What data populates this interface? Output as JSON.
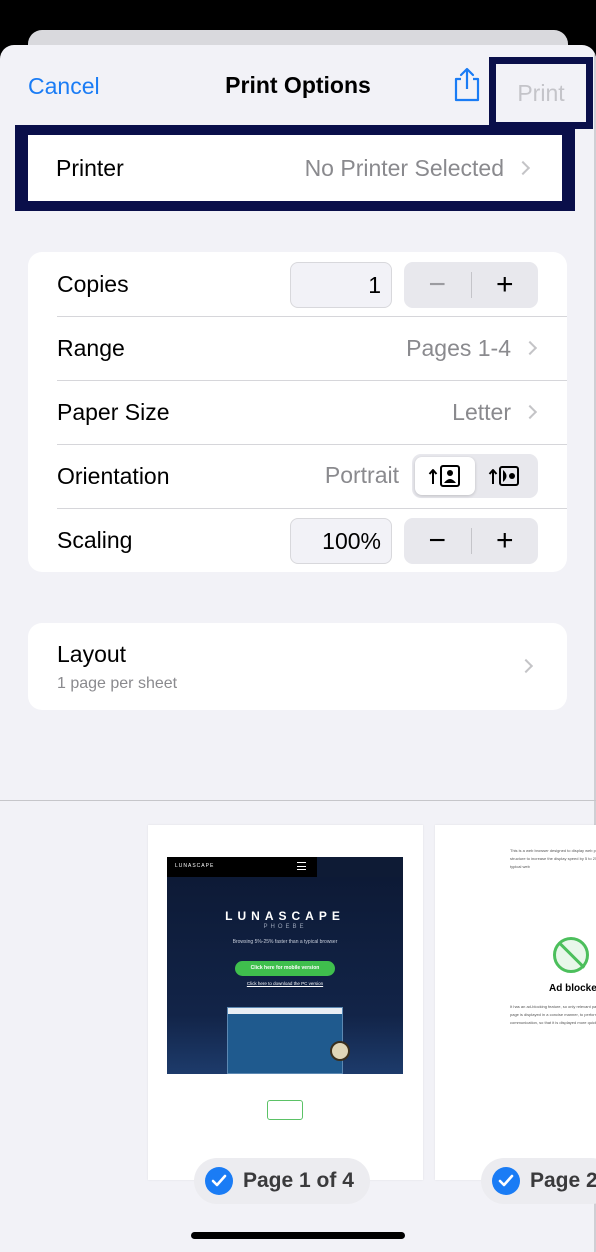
{
  "nav": {
    "cancel_label": "Cancel",
    "title": "Print Options",
    "print_label": "Print"
  },
  "printer": {
    "label": "Printer",
    "value": "No Printer Selected"
  },
  "settings": {
    "copies": {
      "label": "Copies",
      "value": "1",
      "minus": "−",
      "plus": "+"
    },
    "range": {
      "label": "Range",
      "value": "Pages 1-4"
    },
    "paper_size": {
      "label": "Paper Size",
      "value": "Letter"
    },
    "orientation": {
      "label": "Orientation",
      "value": "Portrait",
      "selected": "portrait"
    },
    "scaling": {
      "label": "Scaling",
      "value": "100%",
      "minus": "−",
      "plus": "+"
    }
  },
  "layout": {
    "label": "Layout",
    "subtitle": "1 page per sheet"
  },
  "preview": {
    "pages": [
      {
        "badge": "Page 1 of 4",
        "screenshot": {
          "brand": "LUNASCAPE",
          "title": "LUNASCAPE",
          "subtitle": "PHOEBE",
          "text": "Browsing 5%-25% faster than a typical browser",
          "button": "Click here for mobile version",
          "link": "Click here to download the PC version"
        }
      },
      {
        "badge": "Page 2",
        "text_top": "This is a web browser designed to display web pages with a simple structure to increase the display speed by 5 to 25% compared to a typical web",
        "heading": "Ad blocker",
        "text_bottom": "It has an ad-blocking feature, so only relevant parts of the web page is displayed in a concise manner, to perform unnecessary communication, so that it is displayed more quickly."
      }
    ]
  },
  "colors": {
    "accent": "#1a7cf5",
    "highlight_border": "#0a0f4a",
    "background": "#f2f2f7",
    "secondary_text": "#8a8a8e"
  }
}
